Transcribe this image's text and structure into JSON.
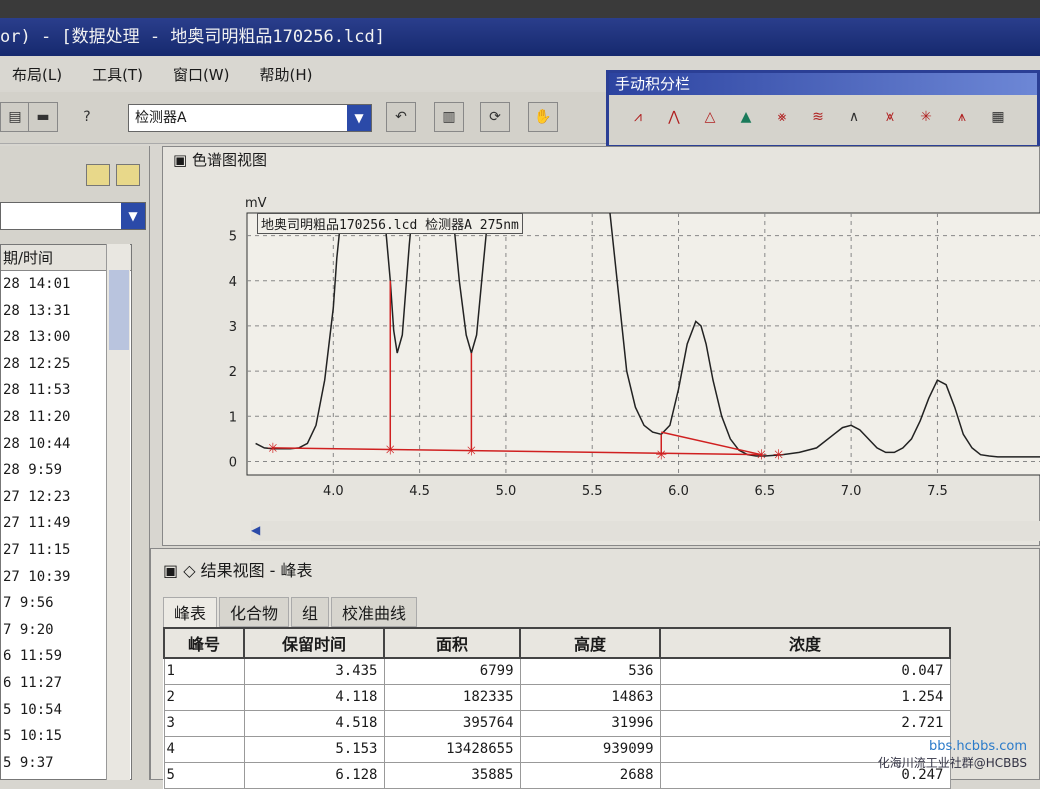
{
  "window": {
    "title": "or) - [数据处理 - 地奥司明粗品170256.lcd]"
  },
  "menu": [
    "布局(L)",
    "工具(T)",
    "窗口(W)",
    "帮助(H)"
  ],
  "toolbar": {
    "help_label": "?",
    "detector_value": "检测器A"
  },
  "integration_panel": {
    "title": "手动积分栏"
  },
  "left_panel": {
    "list_header": "期/时间",
    "rows": [
      "28 14:01",
      "28 13:31",
      "28 13:00",
      "28 12:25",
      "28 11:53",
      "28 11:20",
      "28 10:44",
      "28 9:59",
      "27 12:23",
      "27 11:49",
      "27 11:15",
      "27 10:39",
      "7 9:56",
      "7 9:20",
      "6 11:59",
      "6 11:27",
      "5 10:54",
      "5 10:15",
      "5 9:37"
    ]
  },
  "chart_view": {
    "title": "色谱图视图",
    "trace_label": "地奥司明粗品170256.lcd 检测器A 275nm"
  },
  "chart_data": {
    "type": "line",
    "ylabel": "mV",
    "xlim": [
      3.5,
      8.1
    ],
    "ylim": [
      -0.3,
      5.5
    ],
    "xticks": [
      4.0,
      4.5,
      5.0,
      5.5,
      6.0,
      6.5,
      7.0,
      7.5
    ],
    "yticks": [
      0,
      1,
      2,
      3,
      4,
      5
    ],
    "grid": true,
    "series": [
      {
        "x": [
          3.55,
          3.6,
          3.65,
          3.7,
          3.75,
          3.8,
          3.85,
          3.9,
          3.95,
          4.0,
          4.02,
          4.05,
          4.07,
          4.09,
          4.1,
          4.12,
          4.14,
          4.18,
          4.22,
          4.26,
          4.3,
          4.33,
          4.35,
          4.37,
          4.4,
          4.42,
          4.44,
          4.46,
          4.48,
          4.5,
          4.52,
          4.6,
          4.66,
          4.7,
          4.73,
          4.77,
          4.8,
          4.83,
          4.86,
          4.89,
          4.92,
          4.94,
          4.96,
          5.0,
          5.1,
          5.3,
          5.5,
          5.55,
          5.6,
          5.65,
          5.7,
          5.75,
          5.8,
          5.85,
          5.9,
          5.95,
          6.0,
          6.05,
          6.1,
          6.13,
          6.16,
          6.2,
          6.25,
          6.3,
          6.35,
          6.4,
          6.45,
          6.5,
          6.6,
          6.7,
          6.8,
          6.9,
          6.95,
          7.0,
          7.05,
          7.1,
          7.15,
          7.2,
          7.25,
          7.3,
          7.35,
          7.4,
          7.45,
          7.5,
          7.55,
          7.6,
          7.65,
          7.7,
          7.75,
          7.8,
          7.85,
          7.9,
          7.95,
          8.0,
          8.1
        ],
        "y": [
          0.4,
          0.3,
          0.28,
          0.28,
          0.28,
          0.3,
          0.4,
          0.8,
          1.8,
          3.4,
          4.5,
          5.6,
          5.6,
          5.6,
          5.6,
          5.6,
          5.6,
          5.6,
          5.6,
          5.6,
          5.3,
          4.0,
          2.9,
          2.4,
          2.8,
          3.8,
          4.8,
          5.6,
          5.6,
          5.6,
          5.6,
          5.6,
          5.6,
          5.2,
          4.0,
          2.8,
          2.4,
          2.8,
          4.0,
          5.2,
          5.6,
          5.6,
          5.6,
          5.6,
          5.6,
          5.6,
          5.6,
          5.6,
          5.6,
          3.8,
          2.0,
          1.2,
          0.8,
          0.65,
          0.6,
          0.8,
          1.6,
          2.6,
          3.1,
          3.0,
          2.6,
          1.8,
          1.0,
          0.5,
          0.25,
          0.15,
          0.12,
          0.12,
          0.15,
          0.2,
          0.3,
          0.6,
          0.75,
          0.8,
          0.7,
          0.5,
          0.3,
          0.2,
          0.2,
          0.3,
          0.5,
          0.9,
          1.4,
          1.8,
          1.7,
          1.2,
          0.6,
          0.3,
          0.15,
          0.12,
          0.1,
          0.1,
          0.1,
          0.1,
          0.1
        ]
      }
    ],
    "integration_markers_x": [
      3.65,
      4.33,
      4.8,
      5.9,
      6.48,
      6.58
    ]
  },
  "result_view": {
    "title": "结果视图 - 峰表",
    "tabs": [
      "峰表",
      "化合物",
      "组",
      "校准曲线"
    ],
    "columns": [
      "峰号",
      "保留时间",
      "面积",
      "高度",
      "浓度"
    ],
    "rows": [
      [
        "1",
        "3.435",
        "6799",
        "536",
        "0.047"
      ],
      [
        "2",
        "4.118",
        "182335",
        "14863",
        "1.254"
      ],
      [
        "3",
        "4.518",
        "395764",
        "31996",
        "2.721"
      ],
      [
        "4",
        "5.153",
        "13428655",
        "939099",
        ""
      ],
      [
        "5",
        "6.128",
        "35885",
        "2688",
        "0.247"
      ]
    ]
  },
  "watermark": {
    "url": "bbs.hcbbs.com",
    "text": "化海川流工业社群@HCBBS"
  }
}
